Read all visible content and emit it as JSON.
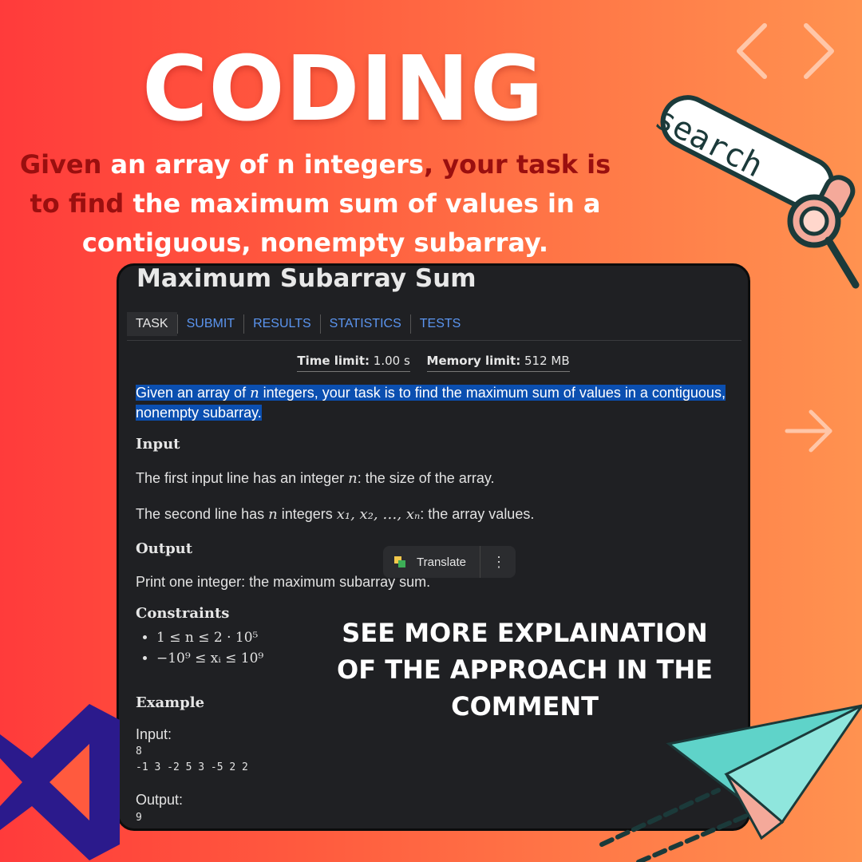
{
  "poster": {
    "headline": "CODING",
    "tagline": {
      "p1": "Given",
      "p2": " an array of n integers",
      "p3": ", your task is",
      "p4": "to find",
      "p5": " the maximum sum of values in a",
      "p6": "contiguous, nonempty subarray."
    },
    "overlay_text": "SEE MORE EXPLAINATION OF THE APPROACH IN THE COMMENT",
    "search_decor_text": "search",
    "colors": {
      "accent_dark_red": "#9a0f0f",
      "panel_bg": "#1f2023",
      "link_blue": "#5b95f0",
      "highlight_blue": "#0b4fb0"
    }
  },
  "problem": {
    "title": "Maximum Subarray Sum",
    "tabs": [
      {
        "label": "TASK"
      },
      {
        "label": "SUBMIT"
      },
      {
        "label": "RESULTS"
      },
      {
        "label": "STATISTICS"
      },
      {
        "label": "TESTS"
      }
    ],
    "time_limit_label": "Time limit:",
    "time_limit_value": "1.00 s",
    "memory_limit_label": "Memory limit:",
    "memory_limit_value": "512 MB",
    "statement": {
      "a": "Given an array of ",
      "var_n": "n",
      "b": " integers, your task is to find the maximum sum of values in a contiguous, nonempty subarray."
    },
    "translate_label": "Translate",
    "translate_more": "⋮",
    "input_heading": "Input",
    "input_line1": {
      "a": "The first input line has an integer ",
      "var": "n",
      "b": ": the size of the array."
    },
    "input_line2": {
      "a": "The second line has ",
      "var": "n",
      "b": " integers ",
      "vars": "x₁, x₂, …, xₙ",
      "c": ": the array values."
    },
    "output_heading": "Output",
    "output_text": "Print one integer: the maximum subarray sum.",
    "constraints_heading": "Constraints",
    "constraints": [
      "1 ≤ n ≤ 2 · 10⁵",
      "−10⁹ ≤ xᵢ ≤ 10⁹"
    ],
    "example_heading": "Example",
    "example_input_label": "Input:",
    "example_input_line1": "8",
    "example_input_line2": "-1 3 -2 5 3 -5 2 2",
    "example_output_label": "Output:",
    "example_output_value": "9"
  }
}
